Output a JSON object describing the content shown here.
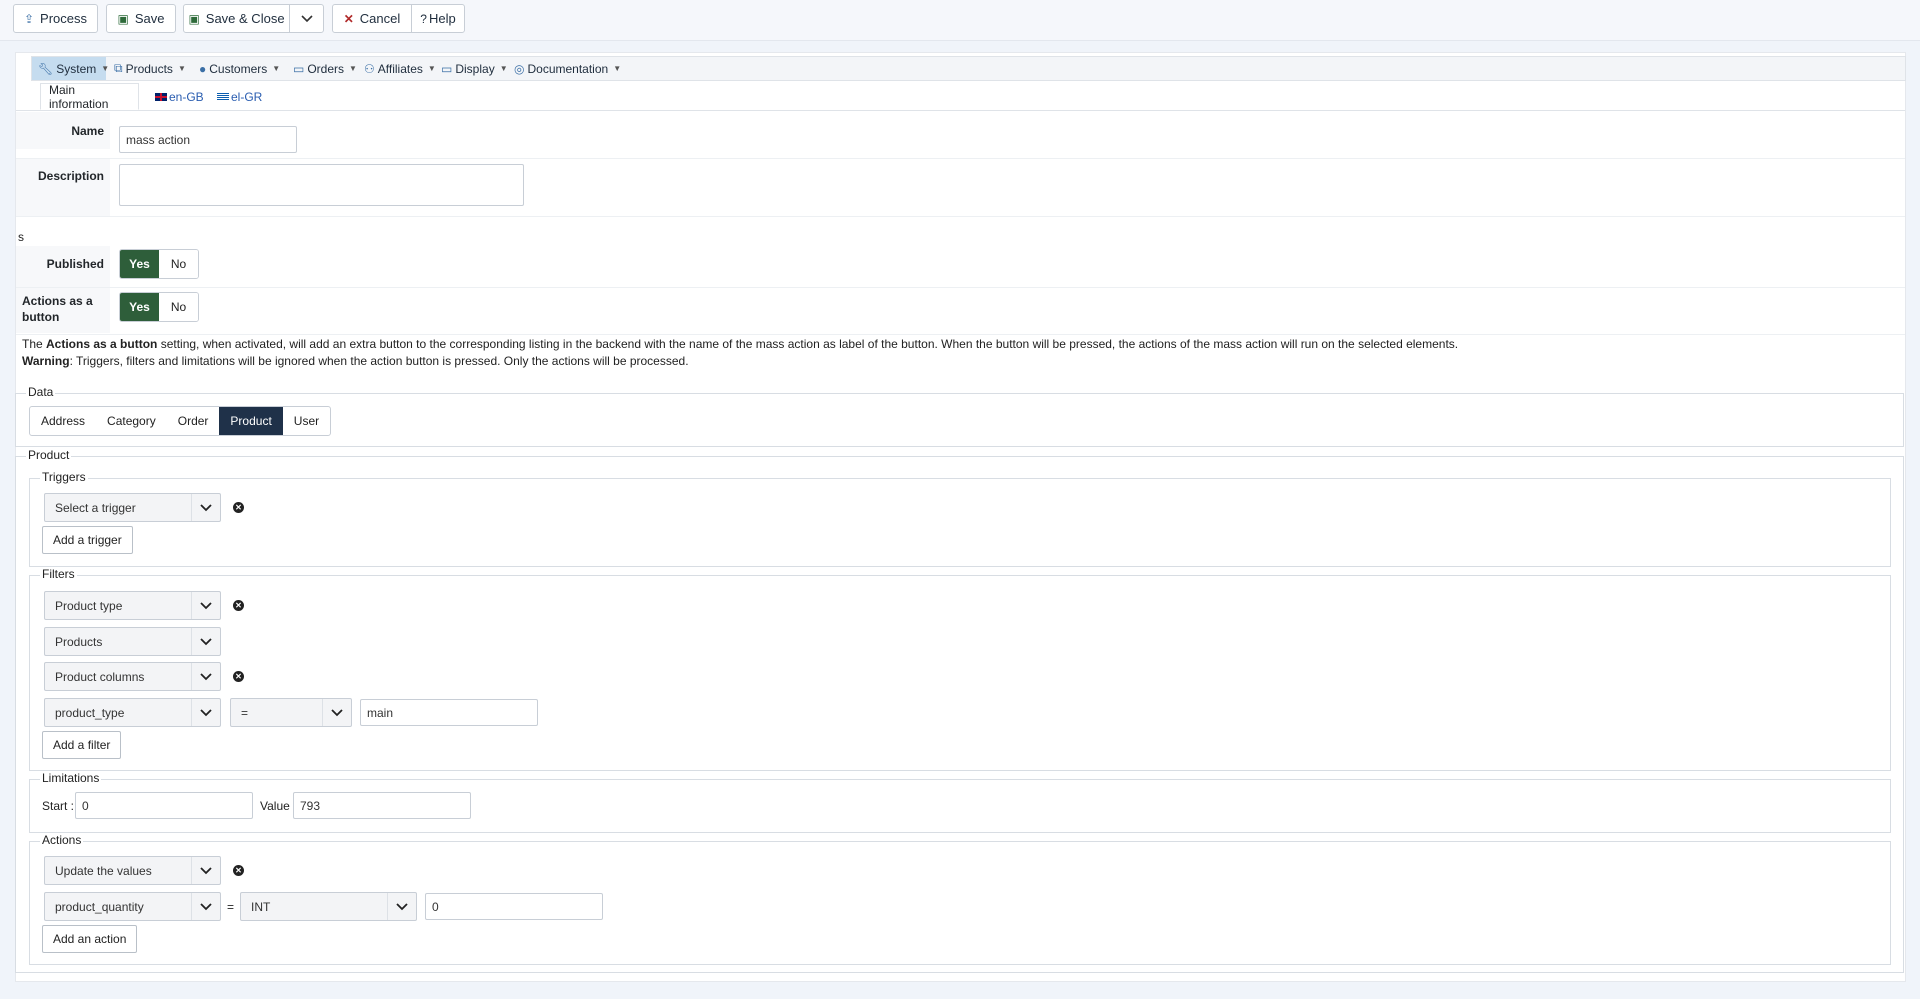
{
  "toolbar": {
    "process": "Process",
    "save": "Save",
    "save_close": "Save & Close",
    "cancel": "Cancel",
    "help": "Help"
  },
  "menu": [
    {
      "label": "System",
      "icon": "wrench-icon"
    },
    {
      "label": "Products",
      "icon": "cubes-icon"
    },
    {
      "label": "Customers",
      "icon": "user-icon"
    },
    {
      "label": "Orders",
      "icon": "credit-card-icon"
    },
    {
      "label": "Affiliates",
      "icon": "users-icon"
    },
    {
      "label": "Display",
      "icon": "desktop-icon"
    },
    {
      "label": "Documentation",
      "icon": "life-ring-icon"
    }
  ],
  "lang_tabs": {
    "main": "Main information",
    "en": "en-GB",
    "el": "el-GR"
  },
  "form": {
    "name_label": "Name",
    "name_value": "mass action",
    "description_label": "Description",
    "description_value": "",
    "stray": "s",
    "published_label": "Published",
    "actions_button_label": "Actions as a button",
    "yes": "Yes",
    "no": "No"
  },
  "info": {
    "line1_pre": "The ",
    "line1_bold": "Actions as a button",
    "line1_post": " setting, when activated, will add an extra button to the corresponding listing in the backend with the name of the mass action as label of the button. When the button will be pressed, the actions of the mass action will run on the selected elements.",
    "line2_bold": "Warning",
    "line2_post": ": Triggers, filters and limitations will be ignored when the action button is pressed. Only the actions will be processed."
  },
  "data_section": {
    "legend": "Data",
    "tabs": [
      "Address",
      "Category",
      "Order",
      "Product",
      "User"
    ],
    "selected": "Product"
  },
  "product_section": {
    "legend": "Product",
    "triggers": {
      "legend": "Triggers",
      "select": "Select a trigger",
      "add": "Add a trigger"
    },
    "filters": {
      "legend": "Filters",
      "type_select": "Product type",
      "products_select": "Products",
      "columns_select": "Product columns",
      "column_select": "product_type",
      "operator_select": "=",
      "value": "main",
      "add": "Add a filter"
    },
    "limitations": {
      "legend": "Limitations",
      "start_label": "Start :",
      "start_value": "0",
      "value_label": "Value :",
      "value_value": "793"
    },
    "actions": {
      "legend": "Actions",
      "action_select": "Update the values",
      "field_select": "product_quantity",
      "equals": "=",
      "type_select": "INT",
      "value": "0",
      "add": "Add an action"
    }
  }
}
